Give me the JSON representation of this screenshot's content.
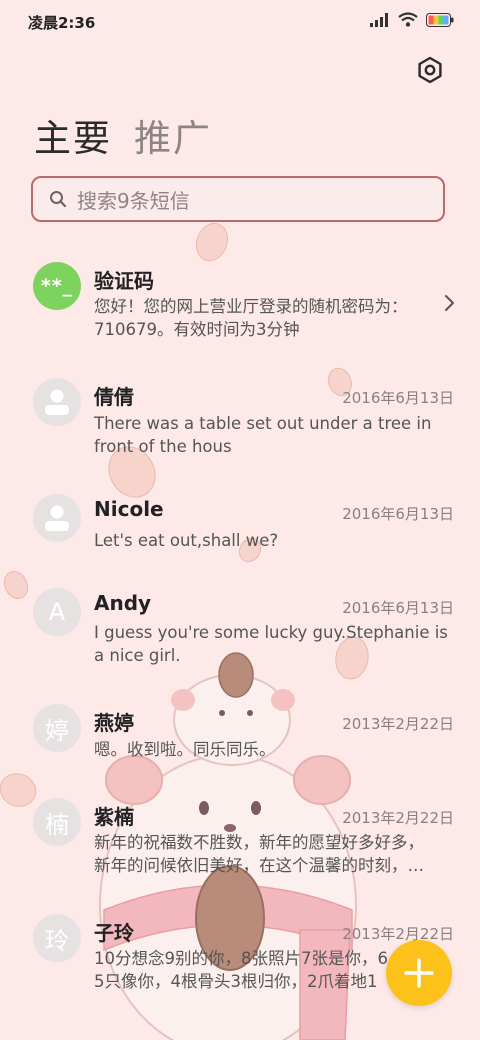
{
  "status_bar": {
    "time": "凌晨2:36"
  },
  "tabs": [
    {
      "label": "主要",
      "active": true
    },
    {
      "label": "推广",
      "active": false
    }
  ],
  "search": {
    "placeholder": "搜索9条短信"
  },
  "messages": [
    {
      "name": "验证码",
      "date": "",
      "avatar": "**_",
      "avatar_color": "#7ed25e",
      "preview": "您好！您的网上营业厅登录的随机密码为：710679。有效时间为3分钟"
    },
    {
      "name": "倩倩",
      "date": "2016年6月13日",
      "avatar": "person-icon",
      "preview": "There was a table set out under a tree in front of the hous"
    },
    {
      "name": "Nicole",
      "date": "2016年6月13日",
      "avatar": "person-icon",
      "preview": "Let's eat out,shall we?"
    },
    {
      "name": "Andy",
      "date": "2016年6月13日",
      "avatar": "A",
      "preview": "I guess you're some lucky guy.Stephanie is a nice girl."
    },
    {
      "name": "燕婷",
      "date": "2013年2月22日",
      "avatar": "婷",
      "preview": "嗯。收到啦。同乐同乐。"
    },
    {
      "name": "紫楠",
      "date": "2013年2月22日",
      "avatar": "楠",
      "preview_lines": [
        "新年的祝福数不胜数，新年的愿望好多好多，",
        "新年的问候依旧美好，在这个温馨的时刻，…"
      ]
    },
    {
      "name": "子玲",
      "date": "2013年2月22日",
      "avatar": "玲",
      "preview_lines": [
        "10分想念9别的你，8张照片7张是你，6",
        "5只像你，4根骨头3根归你，2爪着地1"
      ]
    }
  ],
  "colors": {
    "background": "#fce9e8",
    "search_border": "#b96a6a",
    "fab": "#fcc21b",
    "avatar_gray": "#e6e2e2"
  },
  "icons": {
    "settings": "settings-icon",
    "search": "search-icon",
    "compose": "plus-icon",
    "chevron": "chevron-right-icon"
  }
}
